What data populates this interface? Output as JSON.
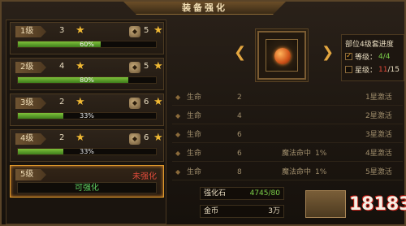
{
  "window": {
    "title": "装备强化"
  },
  "levels": [
    {
      "label": "1级",
      "stars": "3",
      "gems": "5",
      "progress_text": "60%",
      "progress": 0.6
    },
    {
      "label": "2级",
      "stars": "4",
      "gems": "5",
      "progress_text": "80%",
      "progress": 0.8
    },
    {
      "label": "3级",
      "stars": "2",
      "gems": "6",
      "progress_text": "33%",
      "progress": 0.33
    },
    {
      "label": "4级",
      "stars": "2",
      "gems": "6",
      "progress_text": "33%",
      "progress": 0.33
    }
  ],
  "selected_level": {
    "label": "5级",
    "status": "未强化",
    "action": "可强化"
  },
  "set_progress": {
    "title": "部位4级套进度",
    "level_label": "等级：",
    "level_value": "4/4",
    "star_label": "星级：",
    "star_current": "11",
    "star_total": "/15"
  },
  "attributes": [
    {
      "name": "生命",
      "v1": "2",
      "extra": "",
      "v2": "",
      "activate": "1星激活"
    },
    {
      "name": "生命",
      "v1": "4",
      "extra": "",
      "v2": "",
      "activate": "2星激活"
    },
    {
      "name": "生命",
      "v1": "6",
      "extra": "",
      "v2": "",
      "activate": "3星激活"
    },
    {
      "name": "生命",
      "v1": "6",
      "extra": "魔法命中",
      "v2": "1%",
      "activate": "4星激活"
    },
    {
      "name": "生命",
      "v1": "8",
      "extra": "魔法命中",
      "v2": "1%",
      "activate": "5星激活"
    }
  ],
  "costs": [
    {
      "label": "强化石",
      "value": "4745/80"
    },
    {
      "label": "金币",
      "value": "3万"
    }
  ],
  "buttons": {
    "enhance": ""
  },
  "colors": {
    "accent": "#e09a2c",
    "progress_green": "#7fc13a",
    "warn_red": "#e04b3a",
    "ok_green": "#5ed061"
  },
  "icons": {
    "star": "star-icon",
    "gem": "gem-icon",
    "item": "amulet-icon"
  }
}
